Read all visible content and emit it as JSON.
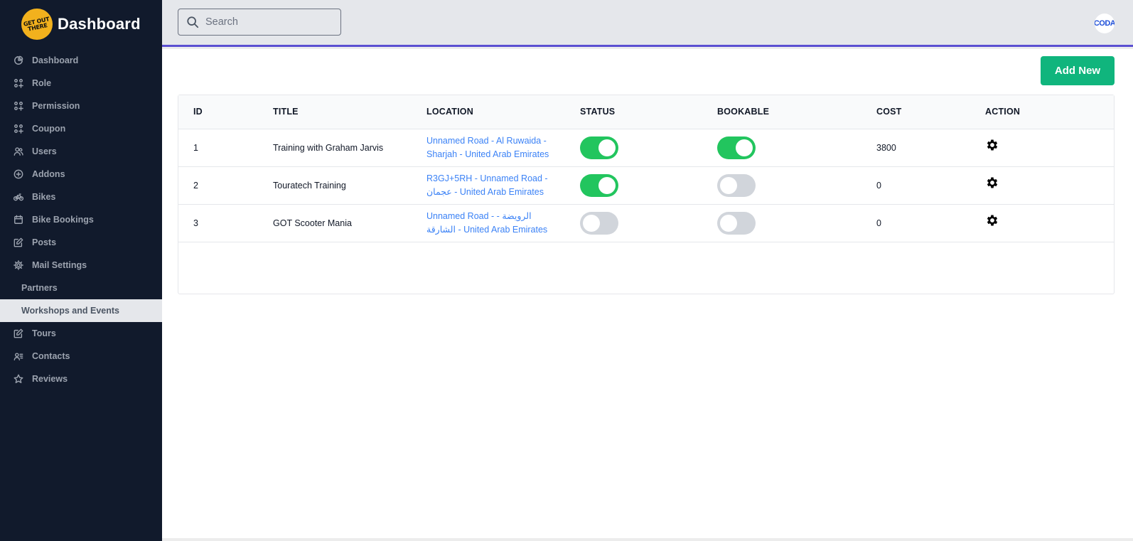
{
  "brand": {
    "logo_text": "GET OUT THERE",
    "title": "Dashboard"
  },
  "sidebar": {
    "items": [
      {
        "label": "Dashboard",
        "icon": "pie-chart-icon"
      },
      {
        "label": "Role",
        "icon": "grid-plus-icon"
      },
      {
        "label": "Permission",
        "icon": "grid-plus-icon"
      },
      {
        "label": "Coupon",
        "icon": "grid-plus-icon"
      },
      {
        "label": "Users",
        "icon": "users-icon"
      },
      {
        "label": "Addons",
        "icon": "plus-circle-icon"
      },
      {
        "label": "Bikes",
        "icon": "bicycle-icon"
      },
      {
        "label": "Bike Bookings",
        "icon": "calendar-icon"
      },
      {
        "label": "Posts",
        "icon": "edit-icon"
      },
      {
        "label": "Mail Settings",
        "icon": "gear-icon"
      },
      {
        "label": "Partners",
        "icon": ""
      },
      {
        "label": "Workshops and Events",
        "icon": ""
      },
      {
        "label": "Tours",
        "icon": "edit-icon"
      },
      {
        "label": "Contacts",
        "icon": "contact-card-icon"
      },
      {
        "label": "Reviews",
        "icon": "star-icon"
      }
    ],
    "active": "Workshops and Events"
  },
  "header": {
    "search": {
      "placeholder": "Search",
      "value": ""
    },
    "avatar_text": "CODA"
  },
  "main": {
    "add_button": "Add New",
    "table": {
      "columns": [
        "ID",
        "TITLE",
        "LOCATION",
        "STATUS",
        "BOOKABLE",
        "COST",
        "ACTION"
      ],
      "rows": [
        {
          "id": "1",
          "title": "Training with Graham Jarvis",
          "location_line1": "Unnamed Road - Al Ruwaida -",
          "location_line2": "Sharjah - United Arab Emirates",
          "status": true,
          "bookable": true,
          "cost": "3800"
        },
        {
          "id": "2",
          "title": "Touratech Training",
          "location_line1": "R3GJ+5RH - Unnamed Road -",
          "location_line2": "عجمان - United Arab Emirates",
          "status": true,
          "bookable": false,
          "cost": "0"
        },
        {
          "id": "3",
          "title": "GOT Scooter Mania",
          "location_line1": "Unnamed Road - - الرويضة",
          "location_line2": "الشارقة - United Arab Emirates",
          "status": false,
          "bookable": false,
          "cost": "0"
        }
      ]
    }
  },
  "colors": {
    "sidebar_bg": "#111a2c",
    "accent_border": "#5b4fd1",
    "add_button": "#10b57d",
    "toggle_on": "#22c55e",
    "toggle_off": "#d1d5db",
    "link": "#3b82f6"
  }
}
